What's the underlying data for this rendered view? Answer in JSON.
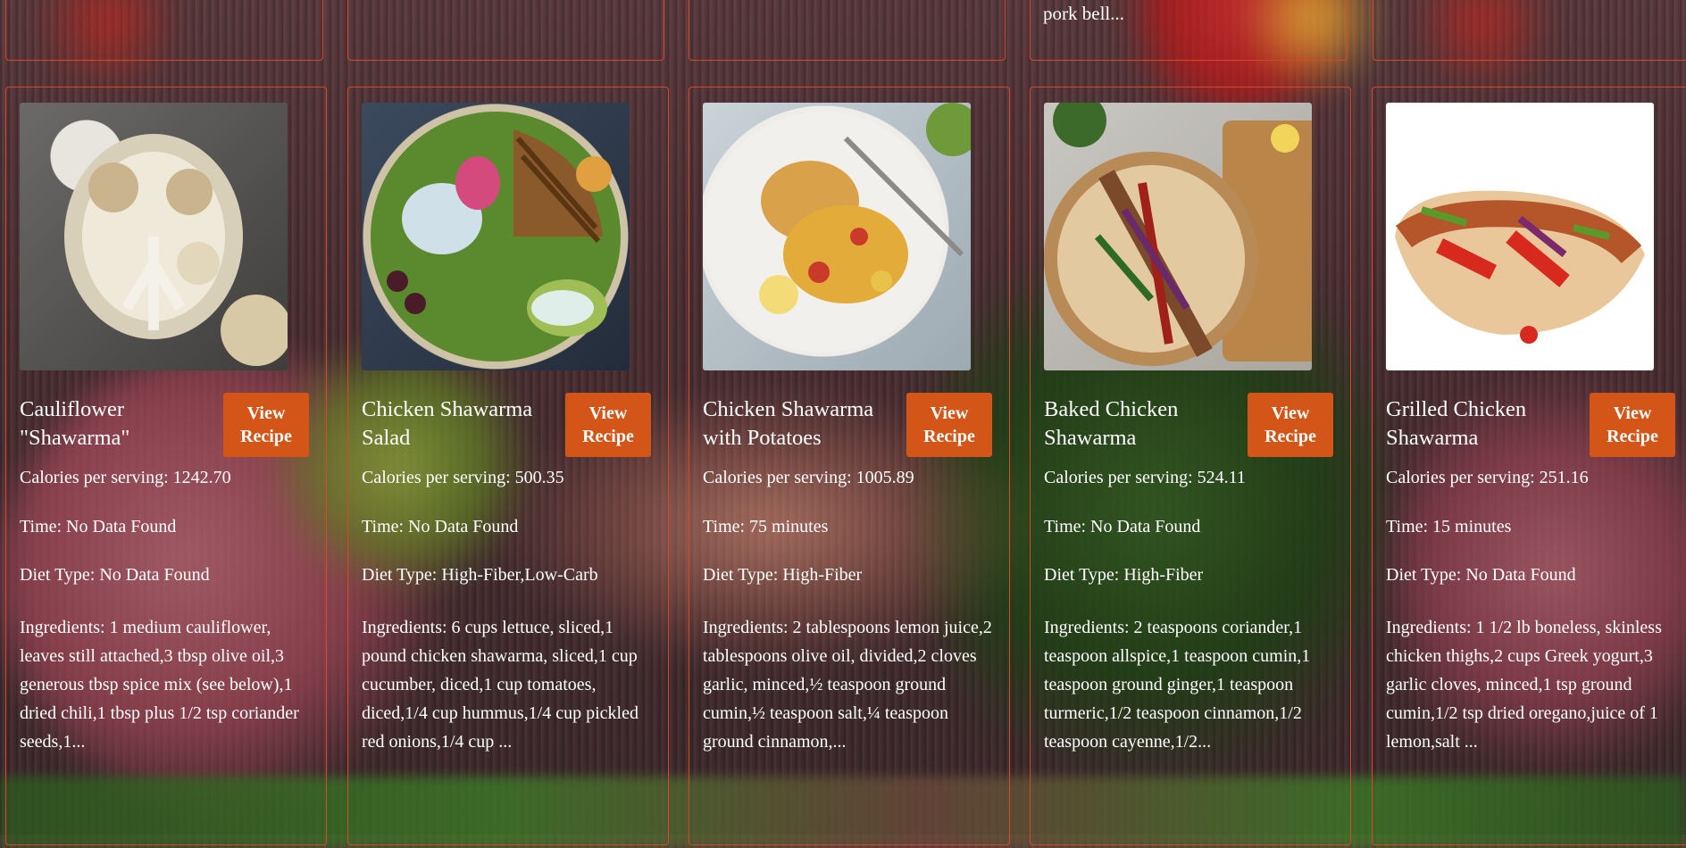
{
  "top_cards": [
    {
      "snippet": ""
    },
    {
      "snippet": ""
    },
    {
      "snippet": ""
    },
    {
      "snippet": "pork bell..."
    },
    {
      "snippet": ""
    }
  ],
  "button_label": "View Recipe",
  "recipes": [
    {
      "title": "Cauliflower \"Shawarma\"",
      "calories": "Calories per serving: 1242.70",
      "time": "Time: No Data Found",
      "diet": "Diet Type: No Data Found",
      "ingredients": "Ingredients: 1 medium cauliflower, leaves still attached,3 tbsp olive oil,3 generous tbsp spice mix (see below),1 dried chili,1 tbsp plus 1/2 tsp coriander seeds,1..."
    },
    {
      "title": "Chicken Shawarma Salad",
      "calories": "Calories per serving: 500.35",
      "time": "Time: No Data Found",
      "diet": "Diet Type: High-Fiber,Low-Carb",
      "ingredients": "Ingredients: 6 cups lettuce, sliced,1 pound chicken shawarma, sliced,1 cup cucumber, diced,1 cup tomatoes, diced,1/4 cup hummus,1/4 cup pickled red onions,1/4 cup ..."
    },
    {
      "title": "Chicken Shawarma with Potatoes",
      "calories": "Calories per serving: 1005.89",
      "time": "Time: 75 minutes",
      "diet": "Diet Type: High-Fiber",
      "ingredients": "Ingredients: 2 tablespoons lemon juice,2 tablespoons olive oil, divided,2 cloves garlic, minced,½ teaspoon ground cumin,½ teaspoon salt,¼ teaspoon ground cinnamon,..."
    },
    {
      "title": "Baked Chicken Shawarma",
      "calories": "Calories per serving: 524.11",
      "time": "Time: No Data Found",
      "diet": "Diet Type: High-Fiber",
      "ingredients": "Ingredients: 2 teaspoons coriander,1 teaspoon allspice,1 teaspoon cumin,1 teaspoon ground ginger,1 teaspoon turmeric,1/2 teaspoon cinnamon,1/2 teaspoon cayenne,1/2..."
    },
    {
      "title": "Grilled Chicken Shawarma",
      "calories": "Calories per serving: 251.16",
      "time": "Time: 15 minutes",
      "diet": "Diet Type: No Data Found",
      "ingredients": "Ingredients: 1 1/2 lb boneless, skinless chicken thighs,2 cups Greek yogurt,3 garlic cloves, minced,1 tsp ground cumin,1/2 tsp dried oregano,juice of 1 lemon,salt ..."
    }
  ],
  "colors": {
    "accent": "#d35518",
    "card_border": "#d9472a",
    "text": "#ffffff"
  }
}
